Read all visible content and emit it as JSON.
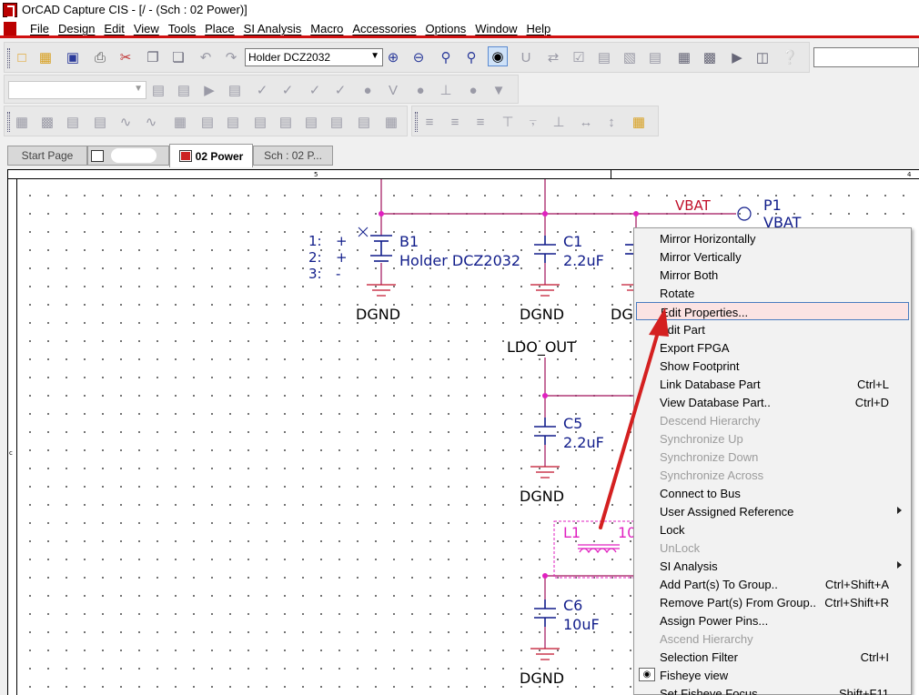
{
  "window": {
    "title": "OrCAD Capture CIS - [/ - (Sch : 02 Power)]"
  },
  "menu": [
    "File",
    "Design",
    "Edit",
    "View",
    "Tools",
    "Place",
    "SI Analysis",
    "Macro",
    "Accessories",
    "Options",
    "Window",
    "Help"
  ],
  "toolbar": {
    "part_value": "Holder DCZ2032"
  },
  "tabs": {
    "start": "Start Page",
    "power": "02 Power",
    "sch": "Sch : 02 P..."
  },
  "ruler": {
    "top_5": "5",
    "top_4": "4",
    "left_c": "c"
  },
  "schematic": {
    "net_vbat": "VBAT",
    "port_ref": "P1",
    "port_val": "VBAT",
    "pins": [
      "1:",
      "+",
      "2:",
      "+",
      "3:",
      "-"
    ],
    "b1_ref": "B1",
    "b1_val": "Holder DCZ2032",
    "c1_ref": "C1",
    "c1_val": "2.2uF",
    "c5_ref": "C5",
    "c5_val": "2.2uF",
    "c6_ref": "C6",
    "c6_val": "10uF",
    "l1_ref": "L1",
    "l1_val": "10",
    "gnd": "DGND",
    "gnd_partial": "DG",
    "ldo_out": "LDO_OUT"
  },
  "context_menu": [
    {
      "label": "Mirror Horizontally",
      "shortcut": "",
      "state": "normal"
    },
    {
      "label": "Mirror Vertically",
      "shortcut": "",
      "state": "normal"
    },
    {
      "label": "Mirror Both",
      "shortcut": "",
      "state": "normal"
    },
    {
      "label": "Rotate",
      "shortcut": "",
      "state": "normal"
    },
    {
      "label": "Edit Properties...",
      "shortcut": "",
      "state": "highlighted"
    },
    {
      "label": "Edit Part",
      "shortcut": "",
      "state": "normal"
    },
    {
      "label": "Export FPGA",
      "shortcut": "",
      "state": "normal"
    },
    {
      "label": "Show Footprint",
      "shortcut": "",
      "state": "normal"
    },
    {
      "label": "Link Database Part",
      "shortcut": "Ctrl+L",
      "state": "normal"
    },
    {
      "label": "View Database Part..",
      "shortcut": "Ctrl+D",
      "state": "normal"
    },
    {
      "label": "Descend Hierarchy",
      "shortcut": "",
      "state": "disabled"
    },
    {
      "label": "Synchronize Up",
      "shortcut": "",
      "state": "disabled"
    },
    {
      "label": "Synchronize Down",
      "shortcut": "",
      "state": "disabled"
    },
    {
      "label": "Synchronize Across",
      "shortcut": "",
      "state": "disabled"
    },
    {
      "label": "Connect to Bus",
      "shortcut": "",
      "state": "normal"
    },
    {
      "label": "User Assigned Reference",
      "shortcut": "",
      "state": "normal",
      "submenu": true
    },
    {
      "label": "Lock",
      "shortcut": "",
      "state": "normal"
    },
    {
      "label": "UnLock",
      "shortcut": "",
      "state": "disabled"
    },
    {
      "label": "SI Analysis",
      "shortcut": "",
      "state": "normal",
      "submenu": true
    },
    {
      "label": "Add Part(s) To Group..",
      "shortcut": "Ctrl+Shift+A",
      "state": "normal"
    },
    {
      "label": "Remove Part(s) From Group..",
      "shortcut": "Ctrl+Shift+R",
      "state": "normal"
    },
    {
      "label": "Assign Power Pins...",
      "shortcut": "",
      "state": "normal"
    },
    {
      "label": "Ascend Hierarchy",
      "shortcut": "",
      "state": "disabled"
    },
    {
      "label": "Selection Filter",
      "shortcut": "Ctrl+I",
      "state": "normal"
    },
    {
      "label": "Fisheye view",
      "shortcut": "",
      "state": "normal",
      "icon": "eye"
    },
    {
      "label": "Set Fisheye Focus",
      "shortcut": "Shift+F11",
      "state": "normal"
    }
  ],
  "colors": {
    "wire": "#a0105a",
    "junction": "#e020c0",
    "net_label": "#c0102a",
    "part_text": "#101c8a",
    "annotation_red": "#d42020",
    "menu_accent": "#d01010"
  }
}
